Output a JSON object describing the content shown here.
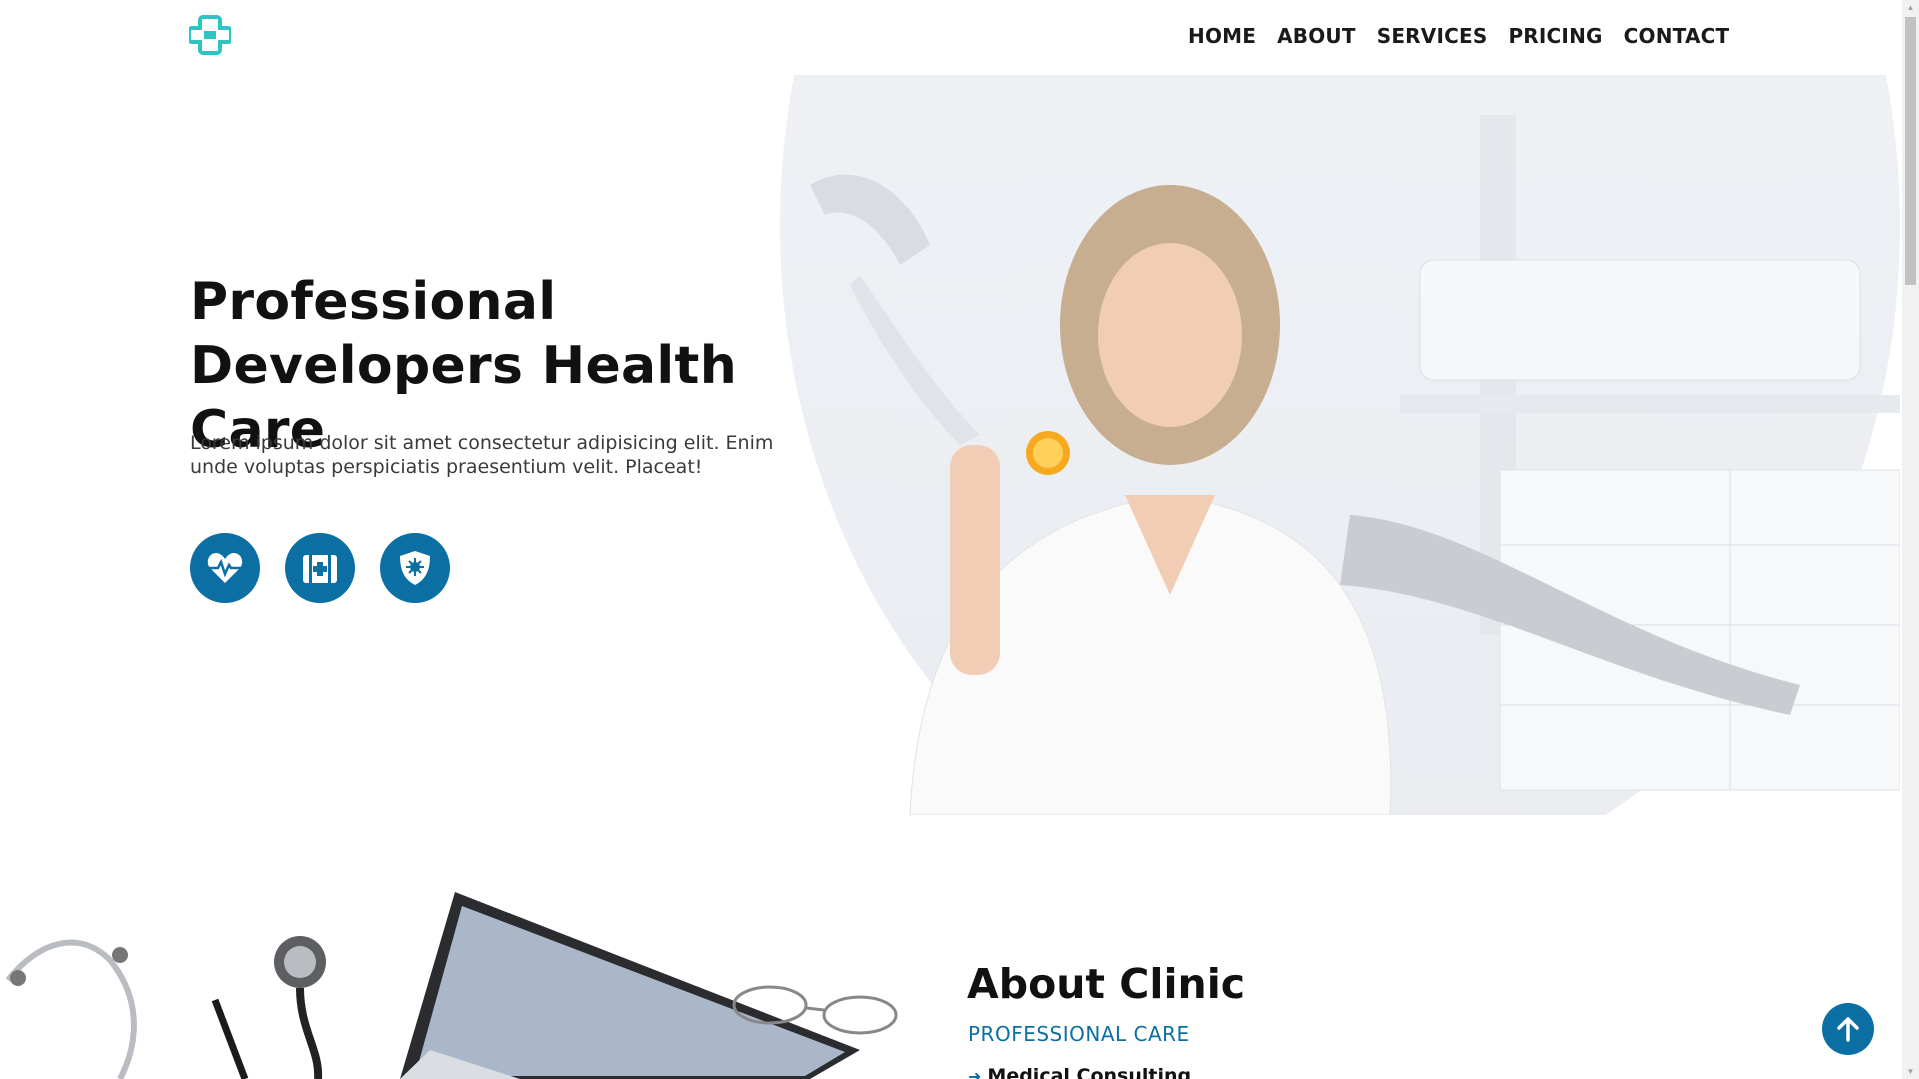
{
  "header": {
    "logo_icon": "medical-cross-icon",
    "nav": [
      "HOME",
      "ABOUT",
      "SERVICES",
      "PRICING",
      "CONTACT"
    ]
  },
  "hero": {
    "title": "Professional Developers Health Care",
    "text": "Lorem ipsum dolor sit amet consectetur adipisicing elit. Enim unde voluptas perspiciatis praesentium velit. Placeat!",
    "icons": [
      "heart-pulse-icon",
      "first-aid-kit-icon",
      "shield-virus-icon"
    ]
  },
  "about": {
    "title": "About Clinic",
    "subtitle": "PROFESSIONAL CARE",
    "first_item": "Medical Consulting"
  },
  "scroll_top_icon": "arrow-up-icon",
  "colors": {
    "accent": "#0b6fa4",
    "logo": "#2ec4c4",
    "text": "#111111"
  }
}
